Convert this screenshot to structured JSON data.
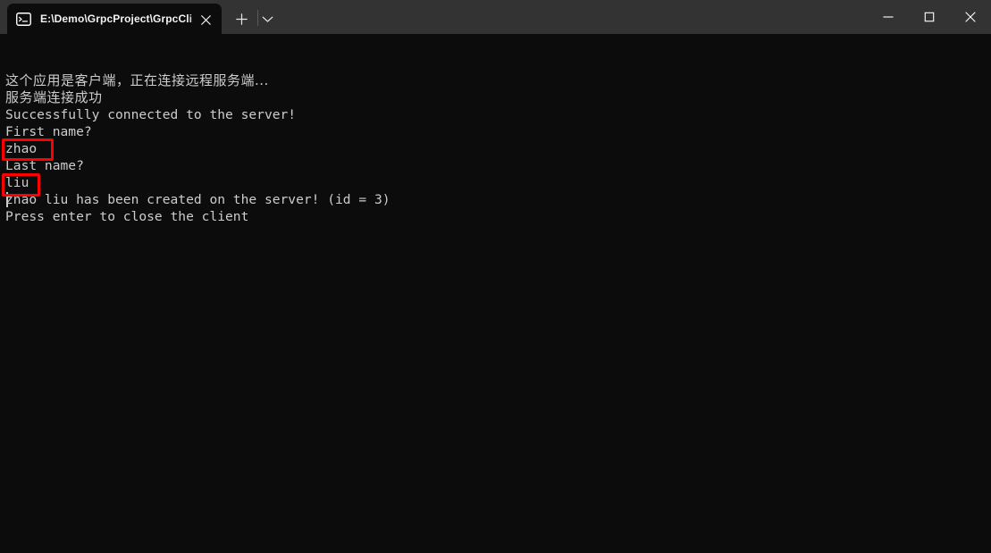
{
  "window": {
    "title_bar": {
      "tab": {
        "icon": "command-prompt-icon",
        "title": "E:\\Demo\\GrpcProject\\GrpcCli",
        "close_label": "✕"
      },
      "new_tab_label": "+",
      "tab_menu_label": "⌄",
      "controls": {
        "minimize_label": "—",
        "maximize_label": "☐",
        "close_label": "✕"
      }
    },
    "colors": {
      "titlebar_bg": "#333333",
      "terminal_bg": "#0c0c0c",
      "terminal_fg": "#cccccc",
      "annotation": "#ff0000"
    }
  },
  "terminal": {
    "lines": [
      {
        "text": "这个应用是客户端，正在连接远程服务端...",
        "cjk": true
      },
      {
        "text": "服务端连接成功",
        "cjk": true
      },
      {
        "text": "Successfully connected to the server!",
        "cjk": false
      },
      {
        "text": "First name?",
        "cjk": false
      },
      {
        "text": "zhao",
        "cjk": false
      },
      {
        "text": "Last name?",
        "cjk": false
      },
      {
        "text": "liu",
        "cjk": false
      },
      {
        "text": "zhao liu has been created on the server! (id = 3)",
        "cjk": false
      },
      {
        "text": "Press enter to close the client",
        "cjk": false
      }
    ],
    "cursor_visible": true
  },
  "annotations": [
    {
      "name": "first-name-input-highlight",
      "target_text": "zhao"
    },
    {
      "name": "last-name-input-highlight",
      "target_text": "liu"
    }
  ]
}
